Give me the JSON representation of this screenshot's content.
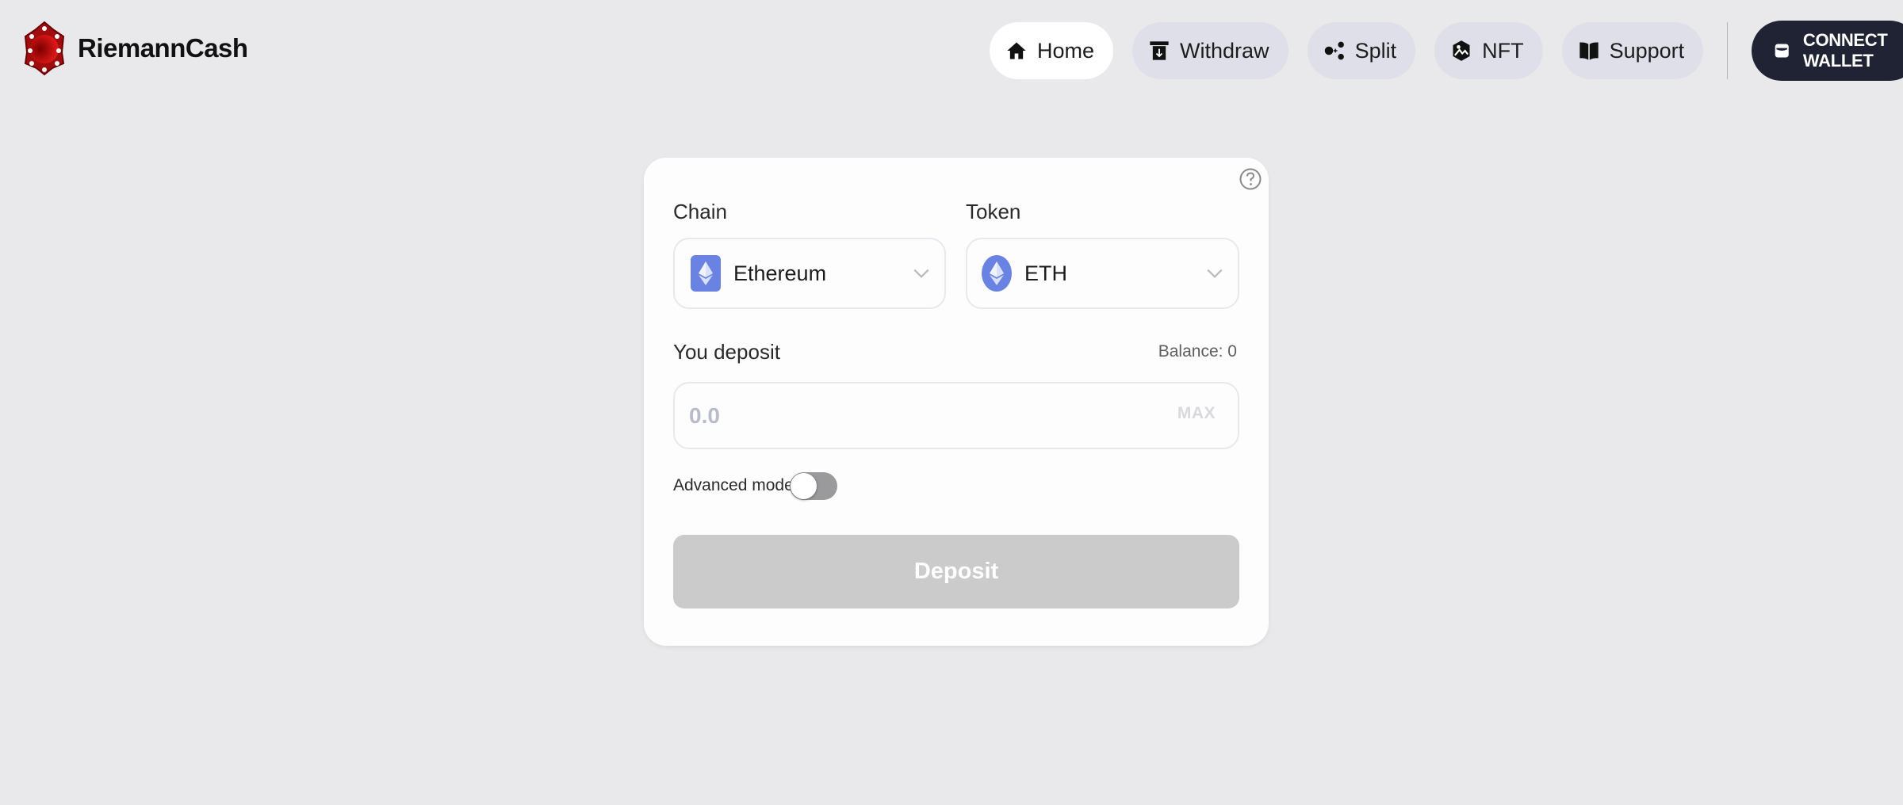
{
  "brand": {
    "name": "RiemannCash",
    "logo_color": "#a00d0d"
  },
  "nav": {
    "items": [
      {
        "label": "Home",
        "icon": "home-icon",
        "active": true
      },
      {
        "label": "Withdraw",
        "icon": "withdraw-icon",
        "active": false
      },
      {
        "label": "Split",
        "icon": "split-icon",
        "active": false
      },
      {
        "label": "NFT",
        "icon": "nft-icon",
        "active": false
      },
      {
        "label": "Support",
        "icon": "book-icon",
        "active": false
      }
    ],
    "connect_label": "CONNECT WALLET"
  },
  "deposit_card": {
    "help_icon": "question-circle-icon",
    "chain": {
      "label": "Chain",
      "selected": "Ethereum",
      "icon": "ethereum-chain-icon"
    },
    "token": {
      "label": "Token",
      "selected": "ETH",
      "icon": "eth-token-icon"
    },
    "amount": {
      "label": "You deposit",
      "balance_text": "Balance: 0",
      "value": "",
      "placeholder": "0.0",
      "max_label": "MAX"
    },
    "advanced_mode": {
      "label": "Advanced mode",
      "enabled": false
    },
    "submit_label": "Deposit",
    "submit_disabled": true
  },
  "colors": {
    "background": "#e9e9eb",
    "nav_pill": "#dfdfe9",
    "connect_button": "#1f2333",
    "eth_blue": "#6a83e2",
    "disabled_button": "#cbcbcb"
  }
}
